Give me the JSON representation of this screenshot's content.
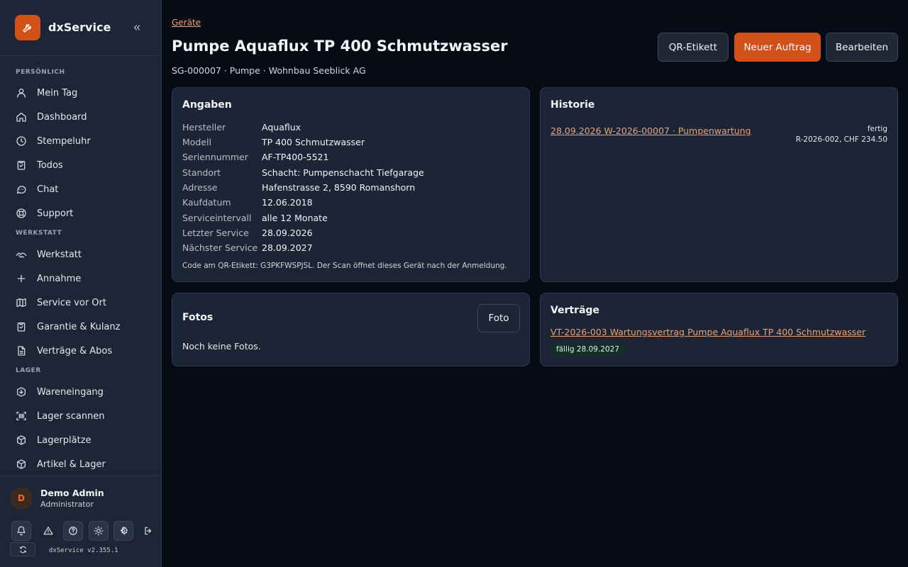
{
  "brand": {
    "name": "dxService"
  },
  "sidebar": {
    "sections": [
      {
        "title": "PERSÖNLICH",
        "items": [
          "Mein Tag",
          "Dashboard",
          "Stempeluhr",
          "Todos",
          "Chat",
          "Support"
        ]
      },
      {
        "title": "WERKSTATT",
        "items": [
          "Werkstatt",
          "Annahme",
          "Service vor Ort",
          "Garantie & Kulanz",
          "Verträge & Abos"
        ]
      },
      {
        "title": "LAGER",
        "items": [
          "Wareneingang",
          "Lager scannen",
          "Lagerplätze",
          "Artikel & Lager"
        ]
      }
    ]
  },
  "user": {
    "initial": "D",
    "name": "Demo Admin",
    "role": "Administrator"
  },
  "version": "dxService v2.355.1",
  "breadcrumb": "Geräte",
  "title": "Pumpe Aquaflux TP 400 Schmutzwasser",
  "subtitle": "SG-000007 · Pumpe · Wohnbau Seeblick AG",
  "actions": {
    "qr": "QR-Etikett",
    "new_order": "Neuer Auftrag",
    "edit": "Bearbeiten"
  },
  "angaben": {
    "title": "Angaben",
    "rows": [
      {
        "label": "Hersteller",
        "value": "Aquaflux"
      },
      {
        "label": "Modell",
        "value": "TP 400 Schmutzwasser"
      },
      {
        "label": "Seriennummer",
        "value": "AF-TP400-5521"
      },
      {
        "label": "Standort",
        "value": "Schacht: Pumpenschacht Tiefgarage"
      },
      {
        "label": "Adresse",
        "value": "Hafenstrasse 2, 8590 Romanshorn"
      },
      {
        "label": "Kaufdatum",
        "value": "12.06.2018"
      },
      {
        "label": "Serviceintervall",
        "value": "alle 12 Monate"
      },
      {
        "label": "Letzter Service",
        "value": "28.09.2026"
      },
      {
        "label": "Nächster Service",
        "value": "28.09.2027"
      }
    ],
    "note": "Code am QR-Etikett: G3PKFWSPJSL. Der Scan öffnet dieses Gerät nach der Anmeldung."
  },
  "historie": {
    "title": "Historie",
    "entries": [
      {
        "link": "28.09.2026 W-2026-00007 · Pumpenwartung",
        "status": "fertig",
        "detail": "R-2026-002, CHF 234.50"
      }
    ]
  },
  "fotos": {
    "title": "Fotos",
    "button": "Foto",
    "empty": "Noch keine Fotos."
  },
  "vertraege": {
    "title": "Verträge",
    "link": "VT-2026-003 Wartungsvertrag Pumpe Aquaflux TP 400 Schmutzwasser",
    "badge": "fällig 28.09.2027"
  },
  "colors": {
    "accent": "#d2501a",
    "background": "#070b16",
    "sidebar": "#1d2636",
    "card": "#1c2535",
    "link": "#f0a070"
  }
}
